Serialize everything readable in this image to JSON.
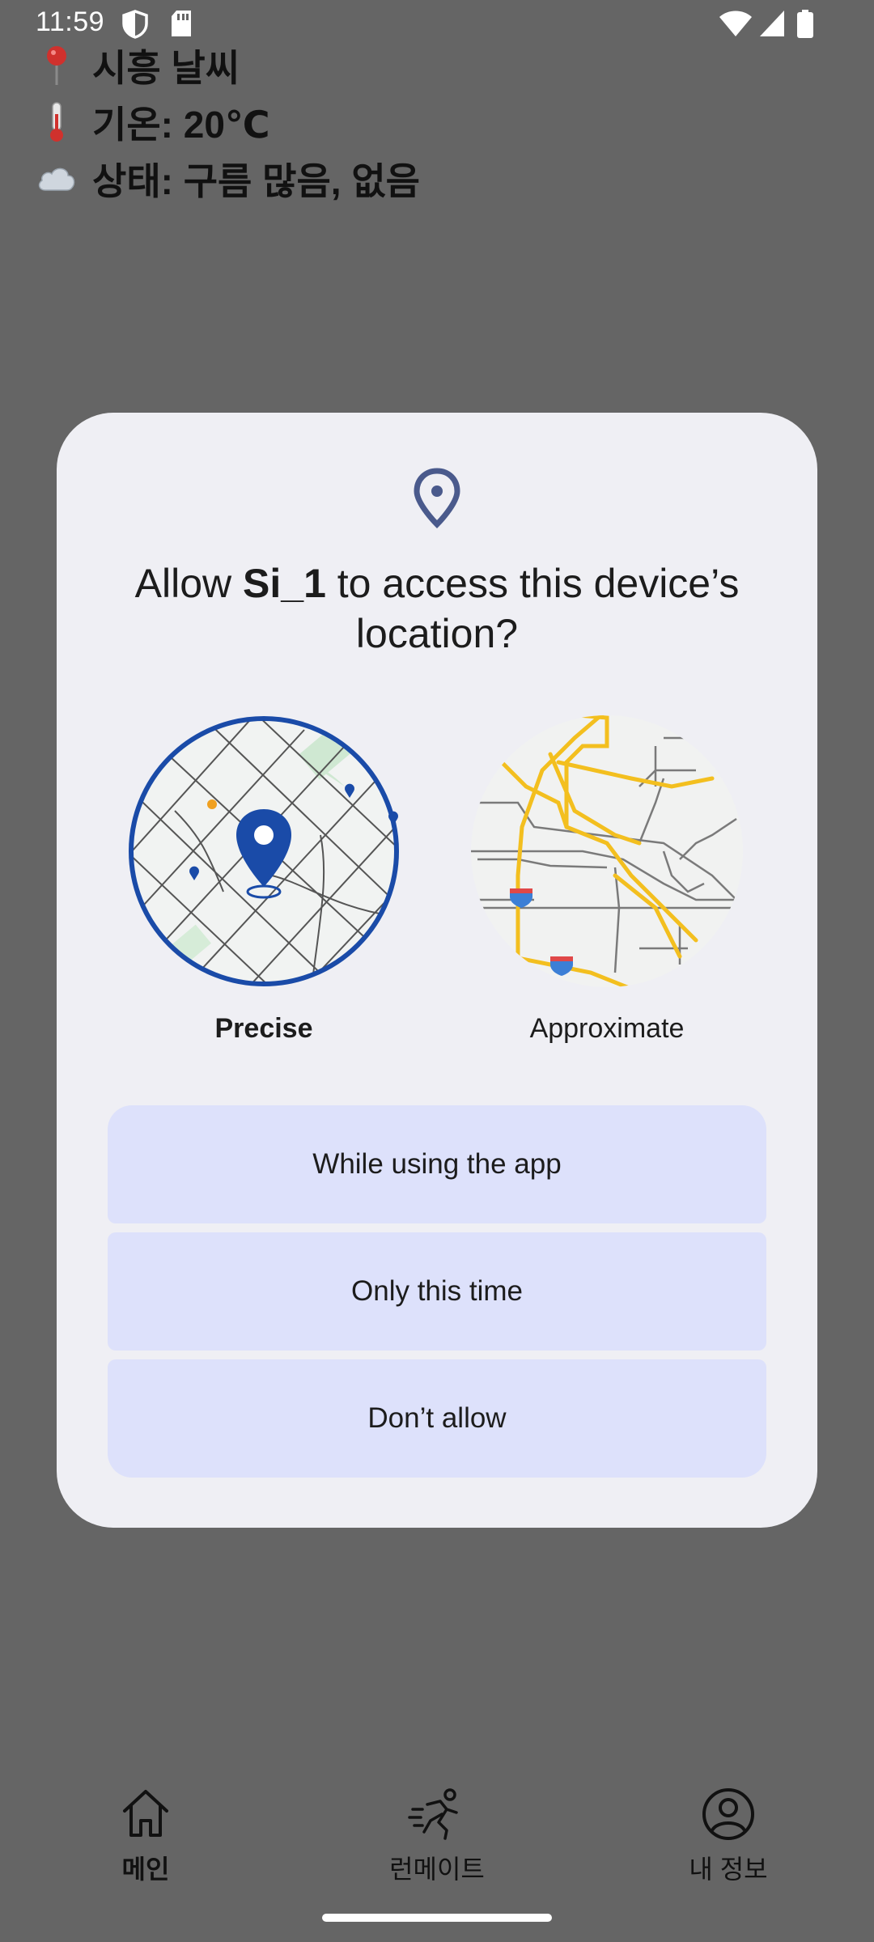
{
  "status_bar": {
    "time": "11:59"
  },
  "weather": {
    "location_emoji": "📍",
    "location": "시흥 날씨",
    "temp_emoji": "🌡️",
    "temperature": "기온: 20℃",
    "cond_emoji": "☁️",
    "condition": "상태: 구름 많음, 없음"
  },
  "dialog": {
    "title_prefix": "Allow ",
    "app_name": "Si_1",
    "title_suffix": " to access this device’s location?",
    "precise_label": "Precise",
    "approximate_label": "Approximate",
    "buttons": {
      "while_using": "While using the app",
      "only_this_time": "Only this time",
      "dont_allow": "Don’t allow"
    },
    "accent_color": "#1a4ba8",
    "button_color": "#dde1fb"
  },
  "bottom_nav": {
    "items": [
      {
        "label": "메인",
        "icon": "home-icon",
        "selected": true
      },
      {
        "label": "런메이트",
        "icon": "runner-icon",
        "selected": false
      },
      {
        "label": "내 정보",
        "icon": "profile-icon",
        "selected": false
      }
    ]
  }
}
